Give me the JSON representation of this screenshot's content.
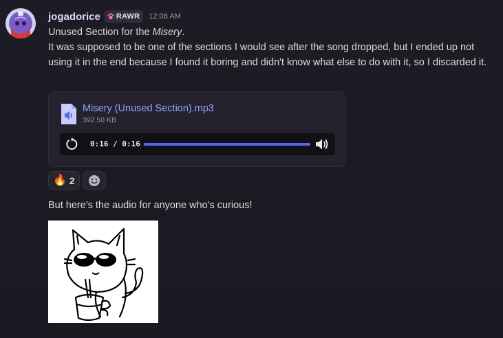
{
  "author": {
    "name": "jogadorice",
    "tag": "RAWR",
    "timestamp": "12:08 AM"
  },
  "message1": {
    "line1_prefix": "Unused Section for the ",
    "line1_italic": "Misery",
    "line1_suffix": ".",
    "body": "It was supposed to be one of the sections I would see after the song dropped, but I ended up not using it in the end because I found it boring and didn't know what else to do with it, so I discarded it."
  },
  "attachment": {
    "filename": "Misery (Unused Section).mp3",
    "size": "392.50 KB",
    "time_display": "0:16 / 0:16",
    "progress_fraction": 1.0
  },
  "reactions": [
    {
      "emoji": "🔥",
      "count": "2"
    }
  ],
  "message2": {
    "text": "But here's the audio for anyone who's curious!"
  },
  "icons": {
    "file": "audio-file-icon",
    "replay": "replay-icon",
    "volume": "volume-icon",
    "add_reaction": "add-reaction-icon"
  },
  "colors": {
    "background": "#1b1a22",
    "username": "#e6d3f7",
    "link": "#8ea6ff",
    "accent": "#5865f2"
  }
}
